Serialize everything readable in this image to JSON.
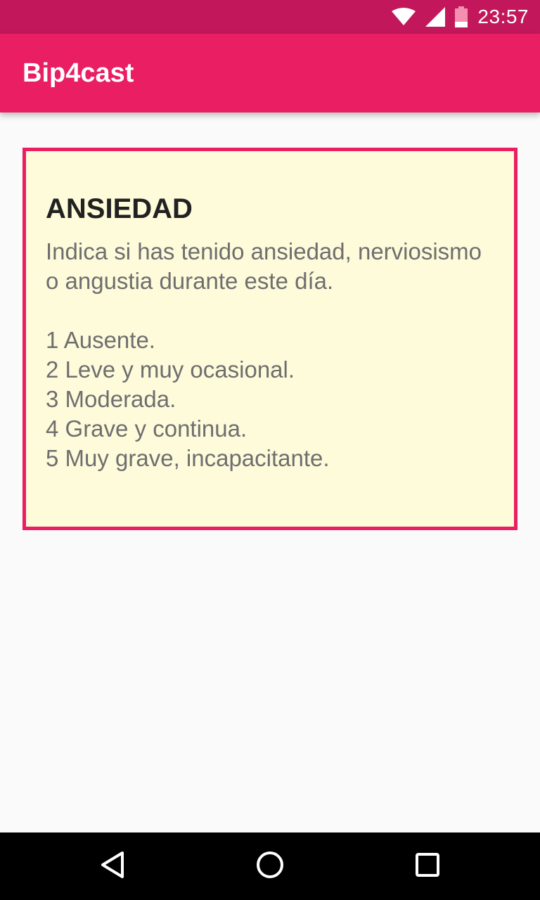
{
  "status_bar": {
    "time": "23:57",
    "icons": [
      "wifi-icon",
      "signal-icon",
      "battery-icon"
    ],
    "bg_color": "#c2185b"
  },
  "app_bar": {
    "title": "Bip4cast",
    "bg_color": "#e91e63"
  },
  "card": {
    "title": "ANSIEDAD",
    "description": "Indica si has tenido ansiedad, nerviosismo o angustia durante este día.",
    "options": [
      "1 Ausente.",
      "2 Leve y muy ocasional.",
      "3 Moderada.",
      "4 Grave y continua.",
      "5 Muy grave, incapacitante."
    ],
    "border_color": "#e91e63",
    "bg_color": "#fefbdb"
  },
  "nav_bar": {
    "buttons": [
      "back-icon",
      "home-icon",
      "recents-icon"
    ]
  }
}
